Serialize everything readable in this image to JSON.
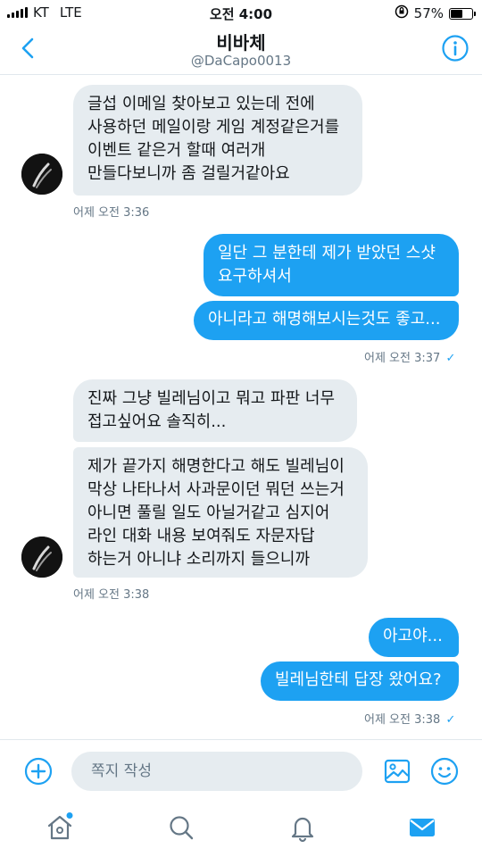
{
  "status_bar": {
    "carrier": "KT",
    "network": "LTE",
    "time": "오전 4:00",
    "battery_percent": "57%",
    "battery_level": 0.57
  },
  "header": {
    "title": "비바체",
    "handle": "@DaCapo0013"
  },
  "messages": [
    {
      "side": "in",
      "text": "글섭 이메일 찾아보고 있는데 전에\n사용하던 메일이랑 게임 계정같은거를\n이벤트 같은거 할때 여러개\n만들다보니까 좀 걸릴거같아요"
    },
    {
      "side": "out",
      "text": "일단 그 분한테 제가 받았던 스샷\n요구하셔서"
    },
    {
      "side": "out",
      "text": "아니라고 해명해보시는것도 좋고..."
    },
    {
      "side": "in",
      "text": "진짜 그냥 빌레님이고 뭐고 파판 너무\n접고싶어요 솔직히..."
    },
    {
      "side": "in",
      "text": "제가 끝가지 해명한다고 해도 빌레님이\n막상 나타나서 사과문이던 뭐던 쓰는거\n아니면 풀릴 일도 아닐거같고 심지어\n라인 대화 내용 보여줘도 자문자답\n하는거 아니냐 소리까지 들으니까"
    },
    {
      "side": "out",
      "text": "아고야..."
    },
    {
      "side": "out",
      "text": "빌레님한테 답장 왔어요?"
    }
  ],
  "timestamps": [
    "어제 오전 3:36",
    "어제 오전 3:37",
    "어제 오전 3:38",
    "어제 오전 3:38"
  ],
  "composer": {
    "placeholder": "쪽지 작성"
  },
  "tabs": [
    {
      "name": "home",
      "icon": "home-icon",
      "has_dot": true
    },
    {
      "name": "search",
      "icon": "search-icon"
    },
    {
      "name": "notifications",
      "icon": "bell-icon"
    },
    {
      "name": "messages",
      "icon": "mail-icon",
      "active": true
    }
  ],
  "colors": {
    "accent": "#1da1f2",
    "incoming_bubble": "#e6ecf0",
    "muted_text": "#657786"
  }
}
